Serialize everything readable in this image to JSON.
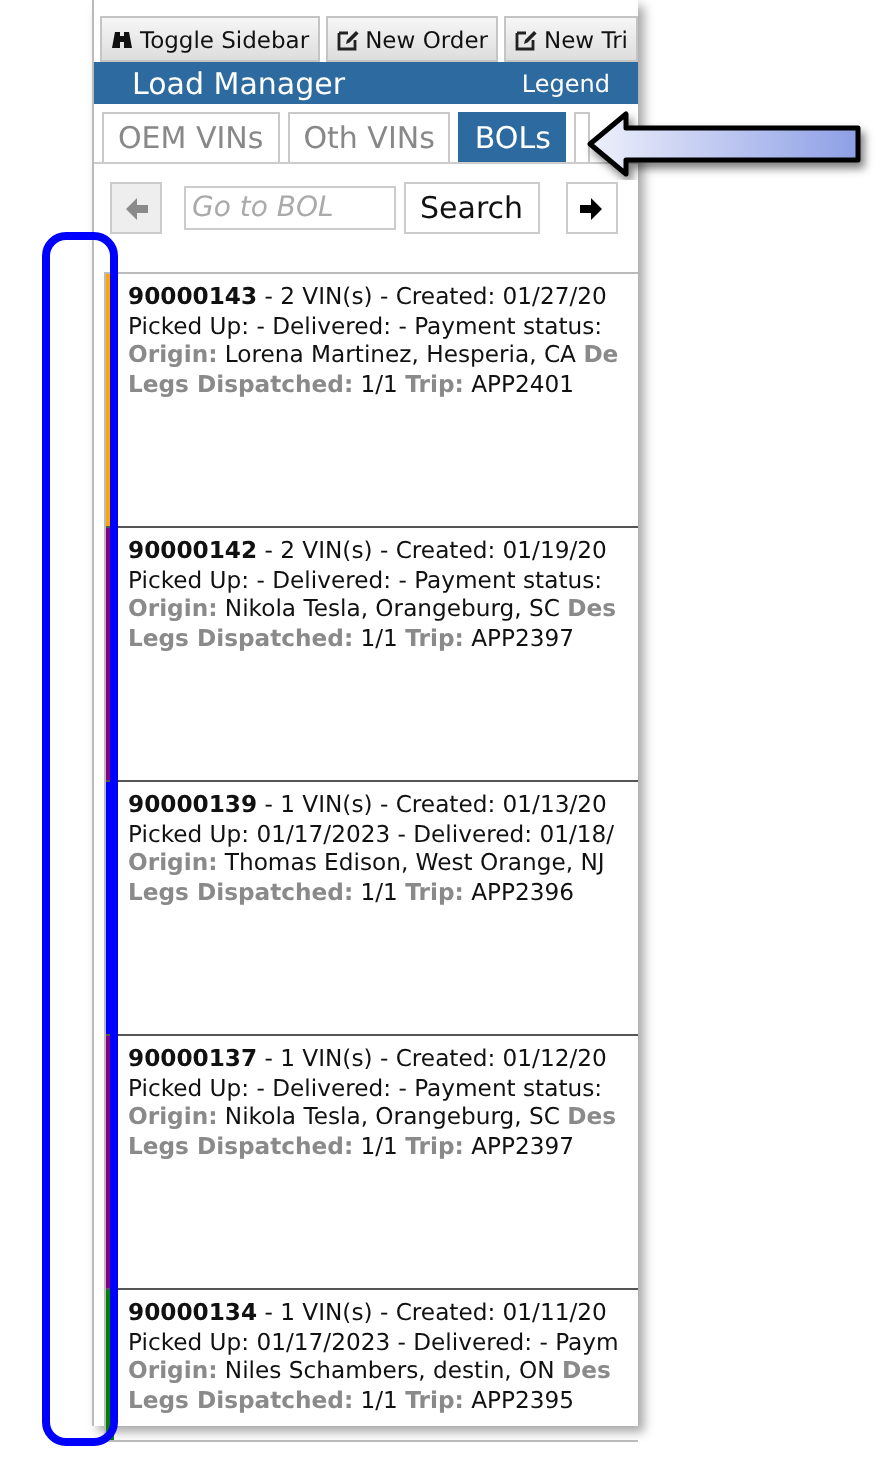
{
  "toolbar": {
    "buttons": [
      {
        "label": "Toggle Sidebar"
      },
      {
        "label": "New Order"
      },
      {
        "label": "New Tri"
      }
    ]
  },
  "header": {
    "title": "Load Manager",
    "legend": "Legend"
  },
  "tabs": [
    {
      "label": "OEM VINs",
      "selected": false
    },
    {
      "label": "Oth VINs",
      "selected": false
    },
    {
      "label": "BOLs",
      "selected": true
    },
    {
      "selected": false
    }
  ],
  "search": {
    "placeholder": "Go to BOL",
    "button": "Search",
    "nav": [
      {
        "kind": "prev",
        "disabled": true
      },
      {
        "kind": "next",
        "disabled": false
      }
    ]
  },
  "bols": [
    {
      "number": "90000143",
      "summary": " - 2 VIN(s) - Created: 01/27/20",
      "status": "Picked Up: - Delivered: - Payment status:",
      "origin_label": "Origin:",
      "origin": "Lorena Martinez, Hesperia, CA",
      "dest_label": "De",
      "legs_label": "Legs Dispatched:",
      "legs": "1/1",
      "trip_label": "Trip:",
      "trip": "APP2401",
      "color": "#ffa500"
    },
    {
      "number": "90000142",
      "summary": " - 2 VIN(s) - Created: 01/19/20",
      "status": "Picked Up: - Delivered: - Payment status:",
      "origin_label": "Origin:",
      "origin": "Nikola Tesla, Orangeburg, SC",
      "dest_label": "Des",
      "legs_label": "Legs Dispatched:",
      "legs": "1/1",
      "trip_label": "Trip:",
      "trip": "APP2397",
      "color": "#800080"
    },
    {
      "number": "90000139",
      "summary": " - 1 VIN(s) - Created: 01/13/20",
      "status": "Picked Up: 01/17/2023 - Delivered: 01/18/",
      "origin_label": "Origin:",
      "origin": "Thomas Edison, West Orange, NJ",
      "legs_label": "Legs Dispatched:",
      "legs": "1/1",
      "trip_label": "Trip:",
      "trip": "APP2396",
      "color": "#0000ff"
    },
    {
      "number": "90000137",
      "summary": " - 1 VIN(s) - Created: 01/12/20",
      "status": "Picked Up: - Delivered: - Payment status:",
      "origin_label": "Origin:",
      "origin": "Nikola Tesla, Orangeburg, SC",
      "dest_label": "Des",
      "legs_label": "Legs Dispatched:",
      "legs": "1/1",
      "trip_label": "Trip:",
      "trip": "APP2397",
      "color": "#800080"
    },
    {
      "number": "90000134",
      "summary": " - 1 VIN(s) - Created: 01/11/20",
      "status": "Picked Up: 01/17/2023 - Delivered: - Paym",
      "origin_label": "Origin:",
      "origin": "Niles Schambers, destin, ON",
      "dest_label": "Des",
      "legs_label": "Legs Dispatched:",
      "legs": "1/1",
      "trip_label": "Trip:",
      "trip": "APP2395",
      "color": "#008000"
    }
  ]
}
